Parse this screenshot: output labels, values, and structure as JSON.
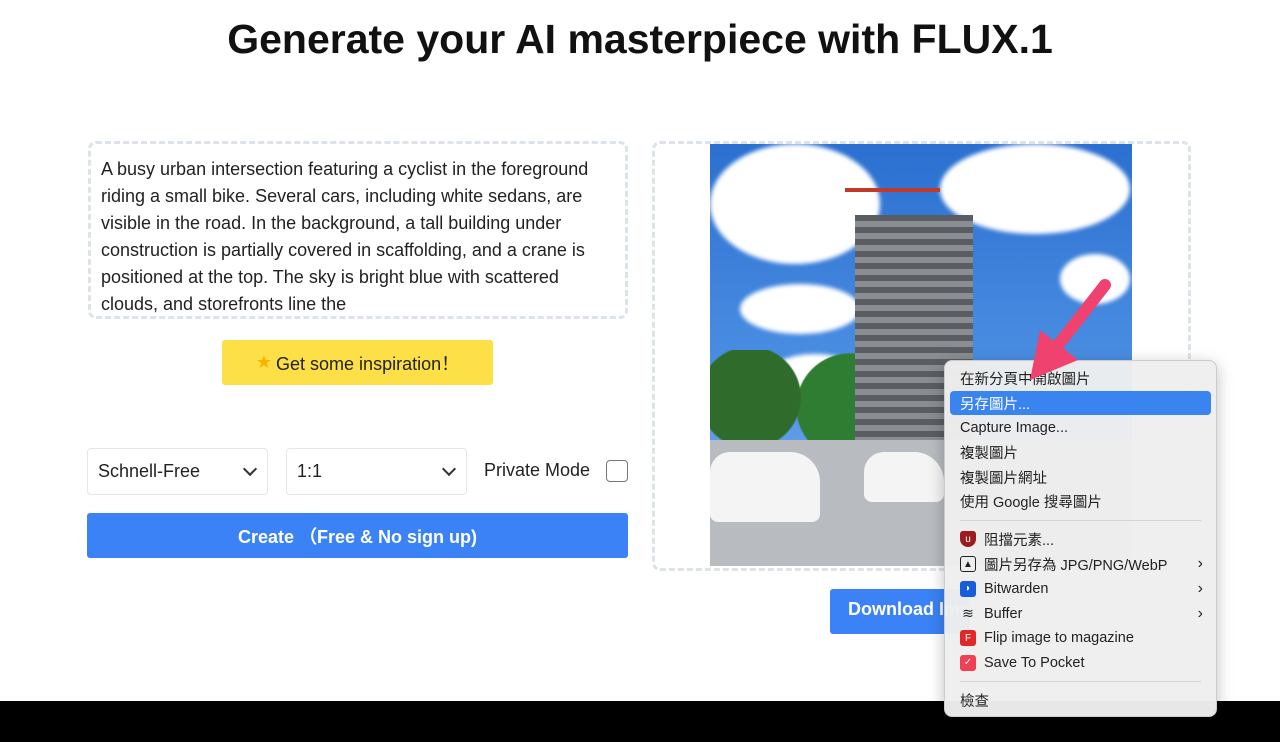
{
  "header": {
    "title": "Generate your AI masterpiece with FLUX.1"
  },
  "prompt": {
    "value": "A busy urban intersection featuring a cyclist in the foreground riding a small bike. Several cars, including white sedans, are visible in the road. In the background, a tall building under construction is partially covered in scaffolding, and a crane is positioned at the top. The sky is bright blue with scattered clouds, and storefronts line the"
  },
  "inspiration": {
    "icon": "star-icon",
    "label": "Get some inspiration！"
  },
  "controls": {
    "model": "Schnell-Free",
    "ratio": "1:1",
    "private_label": "Private Mode",
    "private_checked": false
  },
  "create": {
    "label": "Create （Free & No sign up)"
  },
  "download": {
    "label": "Download Image"
  },
  "context_menu": {
    "items": [
      {
        "label": "在新分頁中開啟圖片"
      },
      {
        "label": "另存圖片...",
        "highlighted": true
      },
      {
        "label": "Capture Image..."
      },
      {
        "label": "複製圖片"
      },
      {
        "label": "複製圖片網址"
      },
      {
        "label": "使用 Google 搜尋圖片"
      }
    ],
    "extensions": [
      {
        "label": "阻擋元素...",
        "icon": "ublock-icon",
        "color": "#9b1c1c"
      },
      {
        "label": "圖片另存為 JPG/PNG/WebP",
        "icon": "image-icon",
        "color": "#222222",
        "submenu": true
      },
      {
        "label": "Bitwarden",
        "icon": "bitwarden-icon",
        "color": "#175ddc",
        "submenu": true
      },
      {
        "label": "Buffer",
        "icon": "buffer-icon",
        "color": "#222222",
        "submenu": true
      },
      {
        "label": "Flip image to magazine",
        "icon": "flipboard-icon",
        "color": "#e12828"
      },
      {
        "label": "Save To Pocket",
        "icon": "pocket-icon",
        "color": "#ef4056"
      }
    ],
    "inspect": "檢查"
  },
  "colors": {
    "accent": "#3b82f6",
    "inspire": "#fde047",
    "highlight": "#3a84f0",
    "arrow": "#f0426e"
  }
}
